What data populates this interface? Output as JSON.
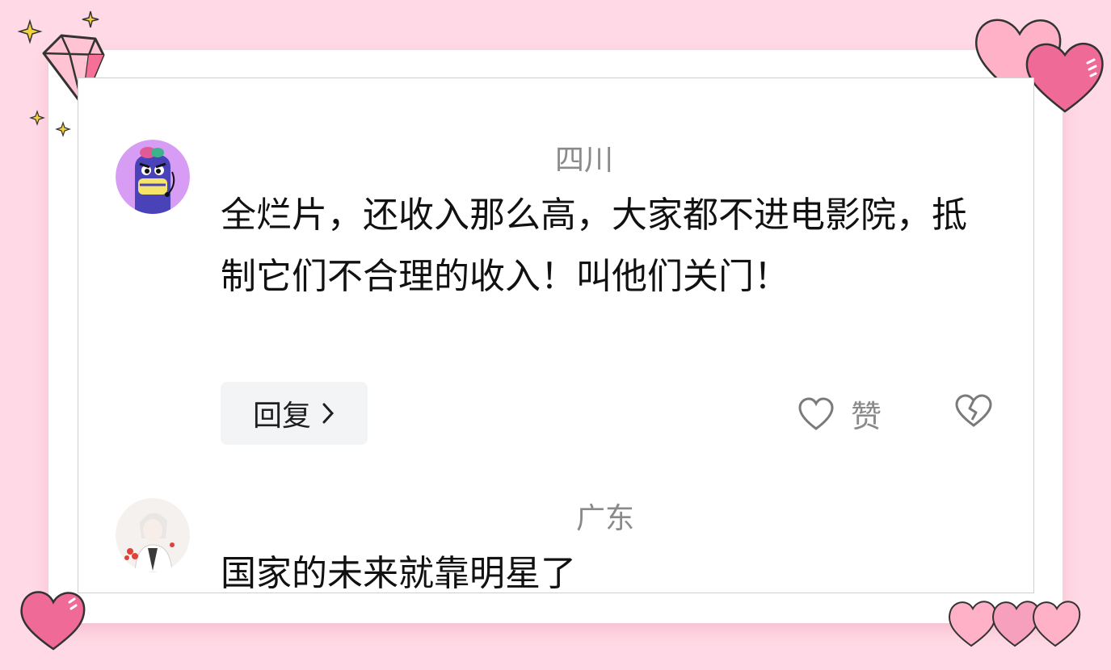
{
  "comments": [
    {
      "location": "四川",
      "text": "全烂片，还收入那么高，大家都不进电影院，抵制它们不合理的收入！叫他们关门！",
      "reply_label": "回复",
      "like_label": "赞"
    },
    {
      "location": "广东",
      "text": "国家的未来就靠明星了"
    }
  ],
  "icons": {
    "reply_arrow": "chevron-right-icon",
    "like": "heart-outline-icon",
    "dislike": "broken-heart-icon"
  },
  "colors": {
    "background": "#ffd9e5",
    "heart": "#f06a98",
    "avatar1_bg": "#d79cf3",
    "avatar1_body": "#4a42b8",
    "sparkle": "#f5d23a"
  }
}
